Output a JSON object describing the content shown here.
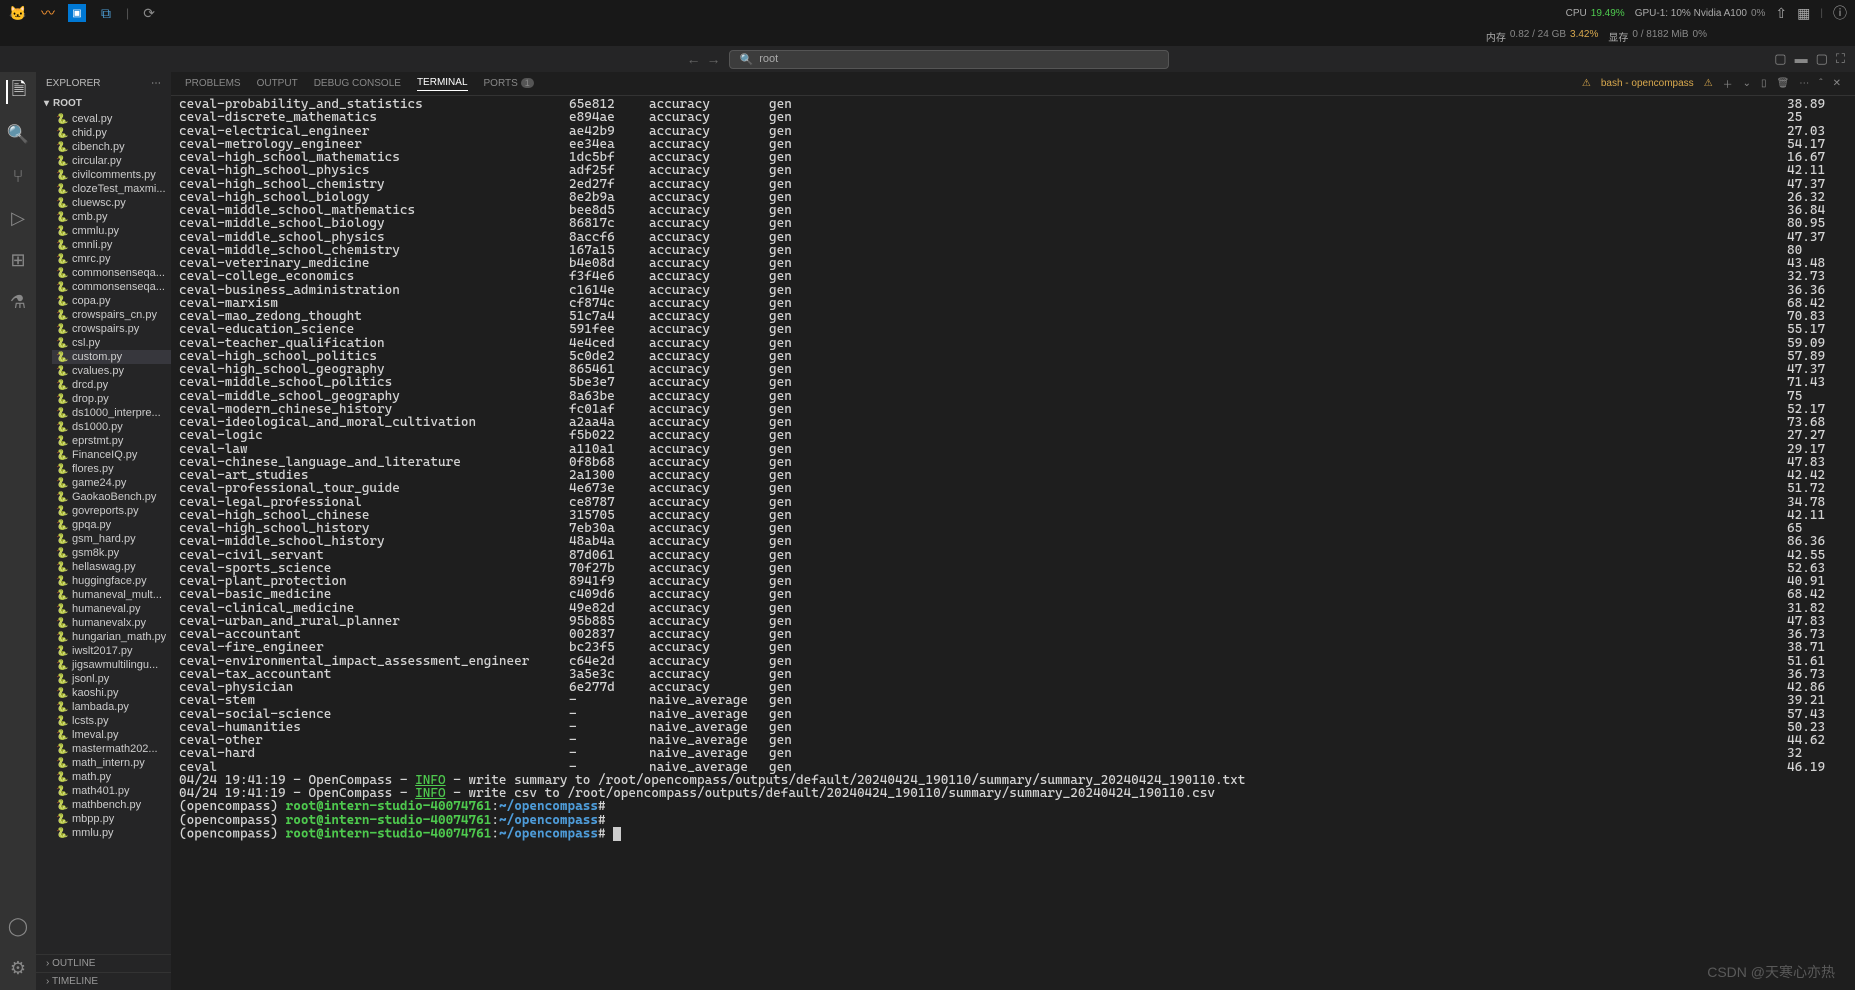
{
  "titlebar": {
    "search_placeholder": "root",
    "metrics": {
      "cpu_label": "CPU",
      "cpu_value": "19.49%",
      "mem_label": "内存",
      "mem_used": "0.82 / 24 GB",
      "mem_pct": "3.42%",
      "gpu_label": "GPU-1: 10% Nvidia A100",
      "gpu_pct": "0%",
      "vram_label": "显存",
      "vram_used": "0 / 8182 MiB",
      "vram_pct": "0%"
    }
  },
  "sidebar": {
    "header": "EXPLORER",
    "root_label": "ROOT",
    "files": [
      "ceval.py",
      "chid.py",
      "cibench.py",
      "circular.py",
      "civilcomments.py",
      "clozeTest_maxmi...",
      "cluewsc.py",
      "cmb.py",
      "cmmlu.py",
      "cmnli.py",
      "cmrc.py",
      "commonsenseqa...",
      "commonsenseqa...",
      "copa.py",
      "crowspairs_cn.py",
      "crowspairs.py",
      "csl.py",
      "custom.py",
      "cvalues.py",
      "drcd.py",
      "drop.py",
      "ds1000_interpre...",
      "ds1000.py",
      "eprstmt.py",
      "FinanceIQ.py",
      "flores.py",
      "game24.py",
      "GaokaoBench.py",
      "govreports.py",
      "gpqa.py",
      "gsm_hard.py",
      "gsm8k.py",
      "hellaswag.py",
      "huggingface.py",
      "humaneval_mult...",
      "humaneval.py",
      "humanevalx.py",
      "hungarian_math.py",
      "iwslt2017.py",
      "jigsawmultilingu...",
      "jsonl.py",
      "kaoshi.py",
      "lambada.py",
      "lcsts.py",
      "lmeval.py",
      "mastermath202...",
      "math_intern.py",
      "math.py",
      "math401.py",
      "mathbench.py",
      "mbpp.py",
      "mmlu.py"
    ],
    "selected_index": 17,
    "outline": "OUTLINE",
    "timeline": "TIMELINE"
  },
  "panel": {
    "tabs": [
      "PROBLEMS",
      "OUTPUT",
      "DEBUG CONSOLE",
      "TERMINAL",
      "PORTS"
    ],
    "ports_badge": "1",
    "active_index": 3,
    "shell_label": "bash - opencompass"
  },
  "terminal_rows": [
    {
      "name": "ceval-probability_and_statistics",
      "hash": "65e812",
      "metric": "accuracy",
      "mode": "gen",
      "score": "38.89"
    },
    {
      "name": "ceval-discrete_mathematics",
      "hash": "e894ae",
      "metric": "accuracy",
      "mode": "gen",
      "score": "25"
    },
    {
      "name": "ceval-electrical_engineer",
      "hash": "ae42b9",
      "metric": "accuracy",
      "mode": "gen",
      "score": "27.03"
    },
    {
      "name": "ceval-metrology_engineer",
      "hash": "ee34ea",
      "metric": "accuracy",
      "mode": "gen",
      "score": "54.17"
    },
    {
      "name": "ceval-high_school_mathematics",
      "hash": "1dc5bf",
      "metric": "accuracy",
      "mode": "gen",
      "score": "16.67"
    },
    {
      "name": "ceval-high_school_physics",
      "hash": "adf25f",
      "metric": "accuracy",
      "mode": "gen",
      "score": "42.11"
    },
    {
      "name": "ceval-high_school_chemistry",
      "hash": "2ed27f",
      "metric": "accuracy",
      "mode": "gen",
      "score": "47.37"
    },
    {
      "name": "ceval-high_school_biology",
      "hash": "8e2b9a",
      "metric": "accuracy",
      "mode": "gen",
      "score": "26.32"
    },
    {
      "name": "ceval-middle_school_mathematics",
      "hash": "bee8d5",
      "metric": "accuracy",
      "mode": "gen",
      "score": "36.84"
    },
    {
      "name": "ceval-middle_school_biology",
      "hash": "86817c",
      "metric": "accuracy",
      "mode": "gen",
      "score": "80.95"
    },
    {
      "name": "ceval-middle_school_physics",
      "hash": "8accf6",
      "metric": "accuracy",
      "mode": "gen",
      "score": "47.37"
    },
    {
      "name": "ceval-middle_school_chemistry",
      "hash": "167a15",
      "metric": "accuracy",
      "mode": "gen",
      "score": "80"
    },
    {
      "name": "ceval-veterinary_medicine",
      "hash": "b4e08d",
      "metric": "accuracy",
      "mode": "gen",
      "score": "43.48"
    },
    {
      "name": "ceval-college_economics",
      "hash": "f3f4e6",
      "metric": "accuracy",
      "mode": "gen",
      "score": "32.73"
    },
    {
      "name": "ceval-business_administration",
      "hash": "c1614e",
      "metric": "accuracy",
      "mode": "gen",
      "score": "36.36"
    },
    {
      "name": "ceval-marxism",
      "hash": "cf874c",
      "metric": "accuracy",
      "mode": "gen",
      "score": "68.42"
    },
    {
      "name": "ceval-mao_zedong_thought",
      "hash": "51c7a4",
      "metric": "accuracy",
      "mode": "gen",
      "score": "70.83"
    },
    {
      "name": "ceval-education_science",
      "hash": "591fee",
      "metric": "accuracy",
      "mode": "gen",
      "score": "55.17"
    },
    {
      "name": "ceval-teacher_qualification",
      "hash": "4e4ced",
      "metric": "accuracy",
      "mode": "gen",
      "score": "59.09"
    },
    {
      "name": "ceval-high_school_politics",
      "hash": "5c0de2",
      "metric": "accuracy",
      "mode": "gen",
      "score": "57.89"
    },
    {
      "name": "ceval-high_school_geography",
      "hash": "865461",
      "metric": "accuracy",
      "mode": "gen",
      "score": "47.37"
    },
    {
      "name": "ceval-middle_school_politics",
      "hash": "5be3e7",
      "metric": "accuracy",
      "mode": "gen",
      "score": "71.43"
    },
    {
      "name": "ceval-middle_school_geography",
      "hash": "8a63be",
      "metric": "accuracy",
      "mode": "gen",
      "score": "75"
    },
    {
      "name": "ceval-modern_chinese_history",
      "hash": "fc01af",
      "metric": "accuracy",
      "mode": "gen",
      "score": "52.17"
    },
    {
      "name": "ceval-ideological_and_moral_cultivation",
      "hash": "a2aa4a",
      "metric": "accuracy",
      "mode": "gen",
      "score": "73.68"
    },
    {
      "name": "ceval-logic",
      "hash": "f5b022",
      "metric": "accuracy",
      "mode": "gen",
      "score": "27.27"
    },
    {
      "name": "ceval-law",
      "hash": "a110a1",
      "metric": "accuracy",
      "mode": "gen",
      "score": "29.17"
    },
    {
      "name": "ceval-chinese_language_and_literature",
      "hash": "0f8b68",
      "metric": "accuracy",
      "mode": "gen",
      "score": "47.83"
    },
    {
      "name": "ceval-art_studies",
      "hash": "2a1300",
      "metric": "accuracy",
      "mode": "gen",
      "score": "42.42"
    },
    {
      "name": "ceval-professional_tour_guide",
      "hash": "4e673e",
      "metric": "accuracy",
      "mode": "gen",
      "score": "51.72"
    },
    {
      "name": "ceval-legal_professional",
      "hash": "ce8787",
      "metric": "accuracy",
      "mode": "gen",
      "score": "34.78"
    },
    {
      "name": "ceval-high_school_chinese",
      "hash": "315705",
      "metric": "accuracy",
      "mode": "gen",
      "score": "42.11"
    },
    {
      "name": "ceval-high_school_history",
      "hash": "7eb30a",
      "metric": "accuracy",
      "mode": "gen",
      "score": "65"
    },
    {
      "name": "ceval-middle_school_history",
      "hash": "48ab4a",
      "metric": "accuracy",
      "mode": "gen",
      "score": "86.36"
    },
    {
      "name": "ceval-civil_servant",
      "hash": "87d061",
      "metric": "accuracy",
      "mode": "gen",
      "score": "42.55"
    },
    {
      "name": "ceval-sports_science",
      "hash": "70f27b",
      "metric": "accuracy",
      "mode": "gen",
      "score": "52.63"
    },
    {
      "name": "ceval-plant_protection",
      "hash": "8941f9",
      "metric": "accuracy",
      "mode": "gen",
      "score": "40.91"
    },
    {
      "name": "ceval-basic_medicine",
      "hash": "c409d6",
      "metric": "accuracy",
      "mode": "gen",
      "score": "68.42"
    },
    {
      "name": "ceval-clinical_medicine",
      "hash": "49e82d",
      "metric": "accuracy",
      "mode": "gen",
      "score": "31.82"
    },
    {
      "name": "ceval-urban_and_rural_planner",
      "hash": "95b885",
      "metric": "accuracy",
      "mode": "gen",
      "score": "47.83"
    },
    {
      "name": "ceval-accountant",
      "hash": "002837",
      "metric": "accuracy",
      "mode": "gen",
      "score": "36.73"
    },
    {
      "name": "ceval-fire_engineer",
      "hash": "bc23f5",
      "metric": "accuracy",
      "mode": "gen",
      "score": "38.71"
    },
    {
      "name": "ceval-environmental_impact_assessment_engineer",
      "hash": "c64e2d",
      "metric": "accuracy",
      "mode": "gen",
      "score": "51.61"
    },
    {
      "name": "ceval-tax_accountant",
      "hash": "3a5e3c",
      "metric": "accuracy",
      "mode": "gen",
      "score": "36.73"
    },
    {
      "name": "ceval-physician",
      "hash": "6e277d",
      "metric": "accuracy",
      "mode": "gen",
      "score": "42.86"
    },
    {
      "name": "ceval-stem",
      "hash": "-",
      "metric": "naive_average",
      "mode": "gen",
      "score": "39.21"
    },
    {
      "name": "ceval-social-science",
      "hash": "-",
      "metric": "naive_average",
      "mode": "gen",
      "score": "57.43"
    },
    {
      "name": "ceval-humanities",
      "hash": "-",
      "metric": "naive_average",
      "mode": "gen",
      "score": "50.23"
    },
    {
      "name": "ceval-other",
      "hash": "-",
      "metric": "naive_average",
      "mode": "gen",
      "score": "44.62"
    },
    {
      "name": "ceval-hard",
      "hash": "-",
      "metric": "naive_average",
      "mode": "gen",
      "score": "32"
    },
    {
      "name": "ceval",
      "hash": "-",
      "metric": "naive_average",
      "mode": "gen",
      "score": "46.19"
    }
  ],
  "log_lines": [
    {
      "ts": "04/24 19:41:19",
      "src": "OpenCompass",
      "lvl": "INFO",
      "msg": "write summary to /root/opencompass/outputs/default/20240424_190110/summary/summary_20240424_190110.txt"
    },
    {
      "ts": "04/24 19:41:19",
      "src": "OpenCompass",
      "lvl": "INFO",
      "msg": "write csv to /root/opencompass/outputs/default/20240424_190110/summary/summary_20240424_190110.csv"
    }
  ],
  "prompt": {
    "env": "(opencompass)",
    "user": "root@intern-studio-40074761",
    "path": "~/opencompass",
    "sep": ":",
    "suffix": "#"
  },
  "watermark": "CSDN @天寒心亦热"
}
